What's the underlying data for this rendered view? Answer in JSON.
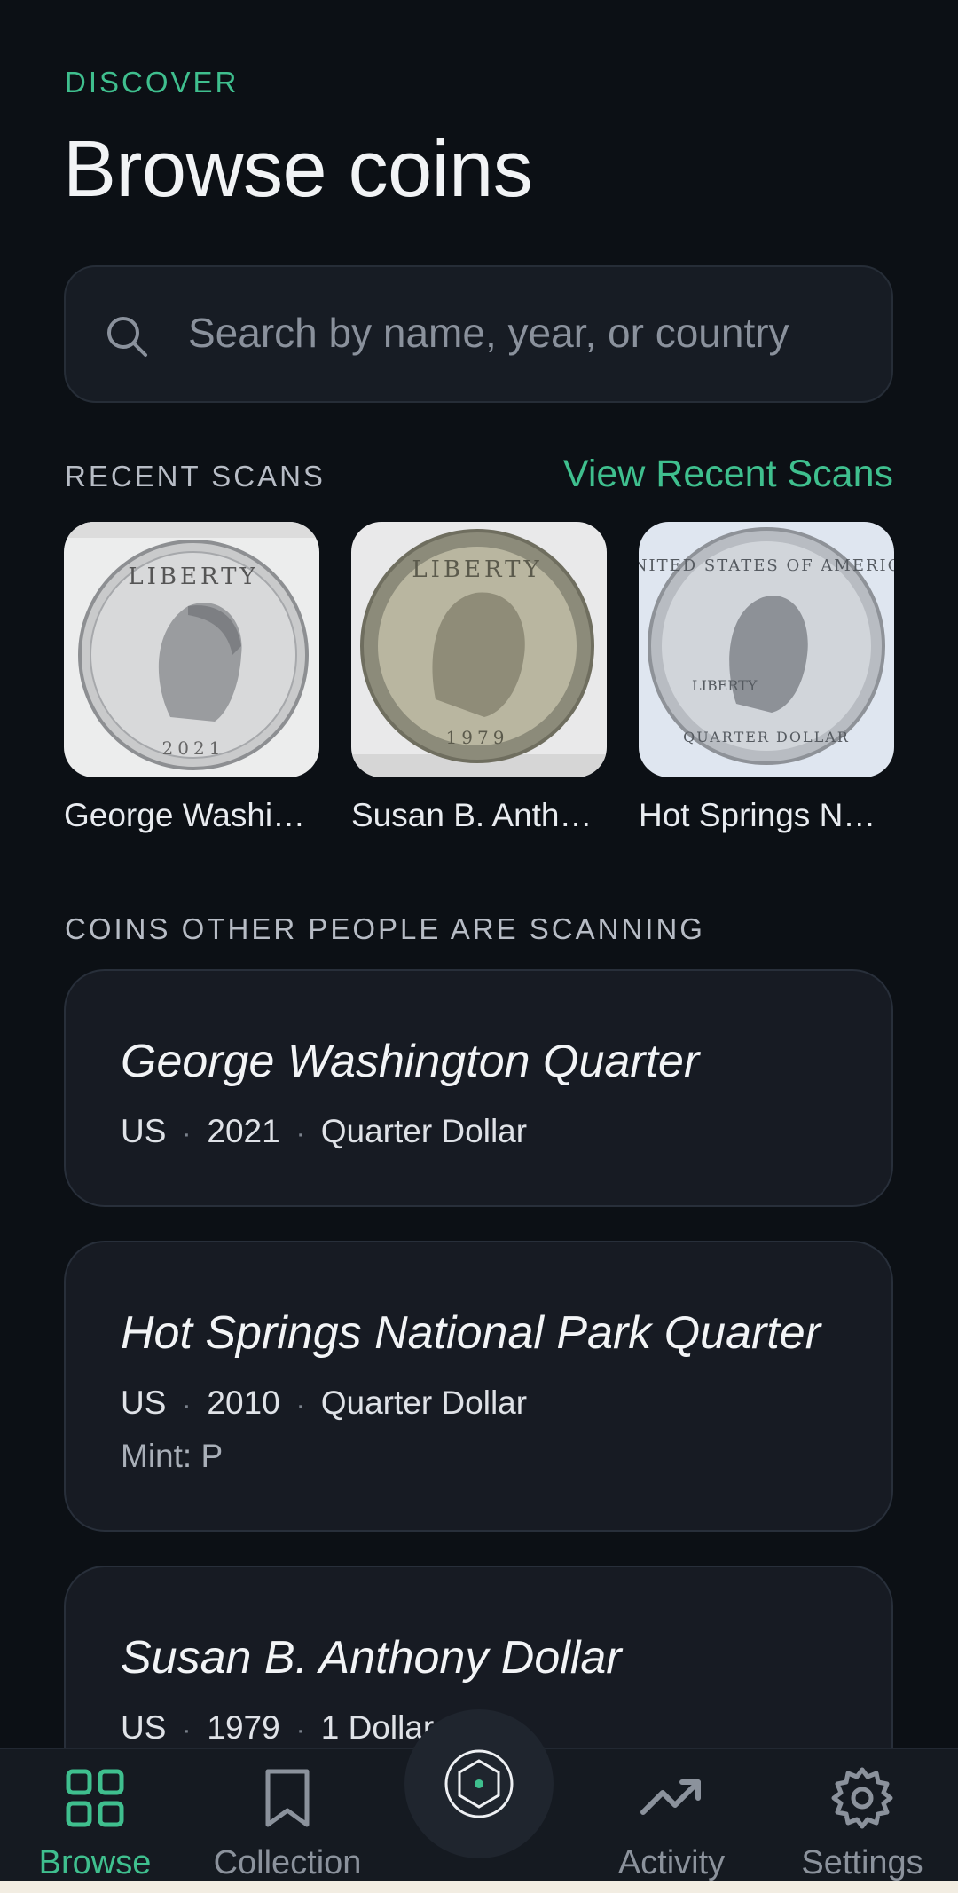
{
  "header": {
    "eyebrow": "DISCOVER",
    "title": "Browse coins"
  },
  "search": {
    "placeholder": "Search by name, year, or country",
    "value": ""
  },
  "recent": {
    "label": "RECENT SCANS",
    "link": "View Recent Scans",
    "items": [
      {
        "caption": "George Washi…"
      },
      {
        "caption": "Susan B. Anth…"
      },
      {
        "caption": "Hot Springs N…"
      }
    ]
  },
  "trending": {
    "label": "COINS OTHER PEOPLE ARE SCANNING",
    "cards": [
      {
        "title": "George Washington Quarter",
        "country": "US",
        "year": "2021",
        "denomination": "Quarter Dollar"
      },
      {
        "title": "Hot Springs National Park Quarter",
        "country": "US",
        "year": "2010",
        "denomination": "Quarter Dollar",
        "mint": "Mint: P"
      },
      {
        "title": "Susan B. Anthony Dollar",
        "country": "US",
        "year": "1979",
        "denomination": "1 Dollar"
      }
    ]
  },
  "nav": {
    "items": [
      {
        "label": "Browse",
        "icon": "grid-icon",
        "active": true
      },
      {
        "label": "Collection",
        "icon": "bookmark-icon"
      },
      {
        "label": "Activity",
        "icon": "trending-up-icon"
      },
      {
        "label": "Settings",
        "icon": "gear-icon"
      }
    ],
    "scan_icon": "hexagon-scan-icon"
  },
  "colors": {
    "background": "#0c1015",
    "accent": "#3fbf8e",
    "card": "#171b23"
  }
}
